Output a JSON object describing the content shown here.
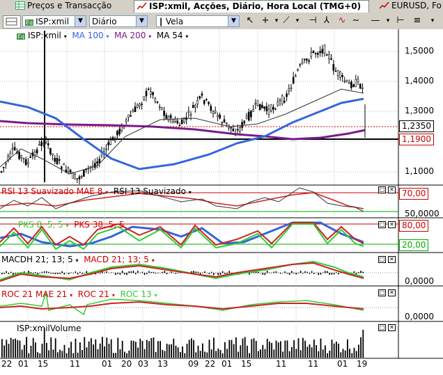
{
  "tabs": [
    {
      "label": "Preços e Transacção",
      "icon": "table-icon"
    },
    {
      "label": "ISP:xmil, Acções, Diário, Hora Local (TMG+0)",
      "icon": "chart-icon"
    },
    {
      "label": "EURUSD, Fo",
      "icon": "chart-icon"
    }
  ],
  "toolbar": {
    "symbol": "ISP:xmil",
    "period": "Diário",
    "style": "Vela",
    "tools": [
      "cursor-icon",
      "crosshair-icon",
      "trendline-icon",
      "zigzag-icon",
      "horizontal-line-icon",
      "more-icon"
    ]
  },
  "main_panel": {
    "symbol_badge": "Eq",
    "symbol": "ISP:xmil",
    "ma100": "MA 100",
    "ma200": "MA 200",
    "ma54": "MA 54",
    "y_ticks": [
      "1,5000",
      "1,4000",
      "1,3000",
      "1,1000"
    ],
    "last_price": "1,2350",
    "level_price": "1,1900",
    "colors": {
      "candle": "#000000",
      "ma100": "#3366dd",
      "ma200": "#7a1a8a",
      "ma54": "#000000",
      "last": "#cc0000"
    }
  },
  "rsi_panel": {
    "label1": "RSI 13 Suavizado MAE 8",
    "label2": "RSI 13 Suavizado",
    "upper": "70,00",
    "lower": "50,0000"
  },
  "pks_panel": {
    "label1": "PKS 8, 5, 5",
    "label2": "PKS 38, 5, 5",
    "upper": "80,00",
    "lower": "20,00"
  },
  "macd_panel": {
    "label1": "MACDH 21; 13; 5",
    "label2": "MACD 21; 13; 5",
    "zero": "0,0000"
  },
  "roc_panel": {
    "label1": "ROC 21 MAE 21",
    "label2": "ROC 21",
    "label3": "ROC 13",
    "zero": "0,0000"
  },
  "volume_panel": {
    "label": "ISP:xmilVolume"
  },
  "x_ticks": [
    "22",
    "01",
    "15",
    "11",
    "01",
    "20",
    "03",
    "13",
    "09",
    "22",
    "01",
    "15",
    "11",
    "11",
    "01",
    "19"
  ]
}
